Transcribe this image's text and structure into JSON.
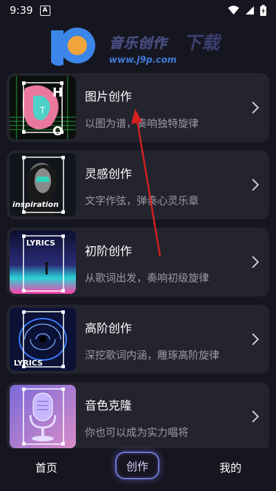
{
  "status_bar": {
    "time": "9:39",
    "notif_letter": "A"
  },
  "watermark": {
    "site_title": "音乐创作",
    "url": "www.j9p.com",
    "big_text": "下载"
  },
  "cards": [
    {
      "title": "图片创作",
      "subtitle": "以图为谱，奏响独特旋律",
      "thumb_icon": "photo-art-thumbnail",
      "thumb_text": "H T O"
    },
    {
      "title": "灵感创作",
      "subtitle": "文字作弦，弹奏心灵乐章",
      "thumb_icon": "inspiration-thumbnail",
      "thumb_text": "inspiration"
    },
    {
      "title": "初阶创作",
      "subtitle": "从歌词出发，奏响初级旋律",
      "thumb_icon": "lyrics-basic-thumbnail",
      "thumb_text": "LYRICS"
    },
    {
      "title": "高阶创作",
      "subtitle": "深挖歌词内涵，雕琢高阶旋律",
      "thumb_icon": "lyrics-advanced-thumbnail",
      "thumb_text": "LYRICS"
    },
    {
      "title": "音色克隆",
      "subtitle": "你也可以成为实力唱将",
      "thumb_icon": "microphone-thumbnail",
      "thumb_text": ""
    }
  ],
  "tabs": {
    "home": "首页",
    "create": "创作",
    "mine": "我的"
  },
  "colors": {
    "background": "#161620",
    "card": "#24242f",
    "accent": "#6a7ad8",
    "subtitle": "#9a9aa8",
    "arrow": "#d62020"
  }
}
